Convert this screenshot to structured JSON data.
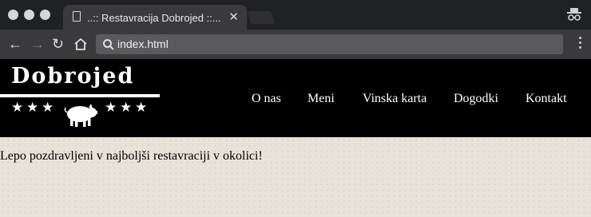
{
  "browser": {
    "tab_title": "..:: Restavracija Dobrojed ::...",
    "tab_close": "✕",
    "address": "index.html",
    "window_controls": [
      "close",
      "minimize",
      "maximize"
    ],
    "icons": [
      "back-arrow-icon",
      "forward-arrow-icon",
      "reload-icon",
      "home-icon",
      "search-icon",
      "incognito-icon",
      "menu-dots-icon"
    ]
  },
  "site": {
    "logo": "Dobrojed",
    "nav": [
      "O nas",
      "Meni",
      "Vinska karta",
      "Dogodki",
      "Kontakt"
    ],
    "greeting": "Lepo pozdravljeni v najboljši restavraciji v okolici!"
  },
  "colors": {
    "browser_frame": "#202124",
    "toolbar": "#3a3a3d",
    "header_bg": "#000000",
    "page_bg": "#e8e3d8"
  }
}
